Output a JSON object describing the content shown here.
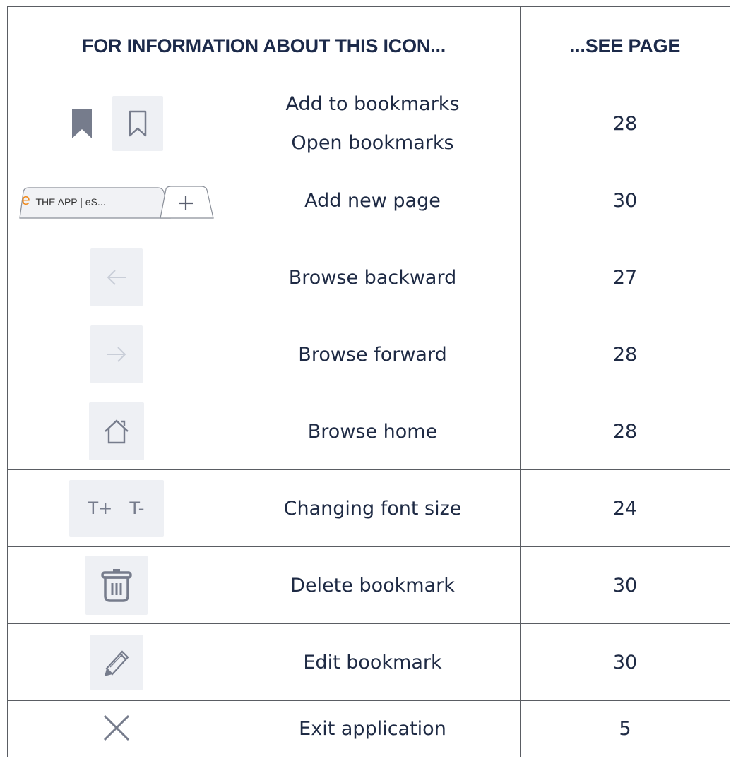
{
  "header": {
    "icon_col": "FOR INFORMATION ABOUT THIS ICON...",
    "page_col": "...SEE PAGE"
  },
  "rows": [
    {
      "icons": [
        "bookmark-filled-icon",
        "bookmark-outline-icon"
      ],
      "descriptions": [
        "Add to bookmarks",
        "Open bookmarks"
      ],
      "page": "28"
    },
    {
      "icons": [
        "browser-tab-icon",
        "new-tab-plus-icon"
      ],
      "tab_text": "THE APP | eS...",
      "tab_letter": "e",
      "description": "Add new page",
      "page": "30"
    },
    {
      "icons": [
        "arrow-left-icon"
      ],
      "description": "Browse backward",
      "page": "27"
    },
    {
      "icons": [
        "arrow-right-icon"
      ],
      "description": "Browse forward",
      "page": "28"
    },
    {
      "icons": [
        "home-icon"
      ],
      "description": "Browse home",
      "page": "28"
    },
    {
      "icons": [
        "font-increase-icon",
        "font-decrease-icon"
      ],
      "font_plus": "T+",
      "font_minus": "T-",
      "description": "Changing font size",
      "page": "24"
    },
    {
      "icons": [
        "trash-icon"
      ],
      "description": "Delete bookmark",
      "page": "30"
    },
    {
      "icons": [
        "pencil-icon"
      ],
      "description": "Edit bookmark",
      "page": "30"
    },
    {
      "icons": [
        "close-icon"
      ],
      "description": "Exit application",
      "page": "5"
    }
  ],
  "colors": {
    "icon_gray": "#767c8c",
    "icon_light": "#c9ced8",
    "icon_bg": "#eef0f4",
    "text_navy": "#1e2a44",
    "tab_accent": "#f08a1c"
  }
}
